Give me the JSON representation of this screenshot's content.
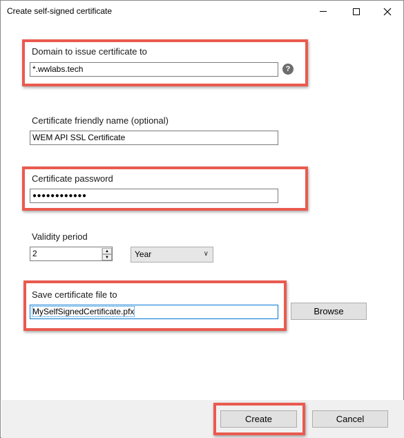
{
  "window": {
    "title": "Create self-signed certificate"
  },
  "domain": {
    "label": "Domain to issue certificate to",
    "value": "*.wwlabs.tech",
    "help_icon": "question-circle-icon"
  },
  "friendly_name": {
    "label": "Certificate friendly name (optional)",
    "value": "WEM API SSL Certificate"
  },
  "password": {
    "label": "Certificate password",
    "value": "●●●●●●●●●●●●"
  },
  "validity": {
    "label": "Validity period",
    "value": "2",
    "unit_selected": "Year"
  },
  "save_file": {
    "label": "Save certificate file to",
    "value": "MySelfSignedCertificate.pfx",
    "browse_label": "Browse"
  },
  "actions": {
    "create_label": "Create",
    "cancel_label": "Cancel"
  },
  "colors": {
    "highlight": "#ea5a4f",
    "focus_border": "#0078d7"
  }
}
